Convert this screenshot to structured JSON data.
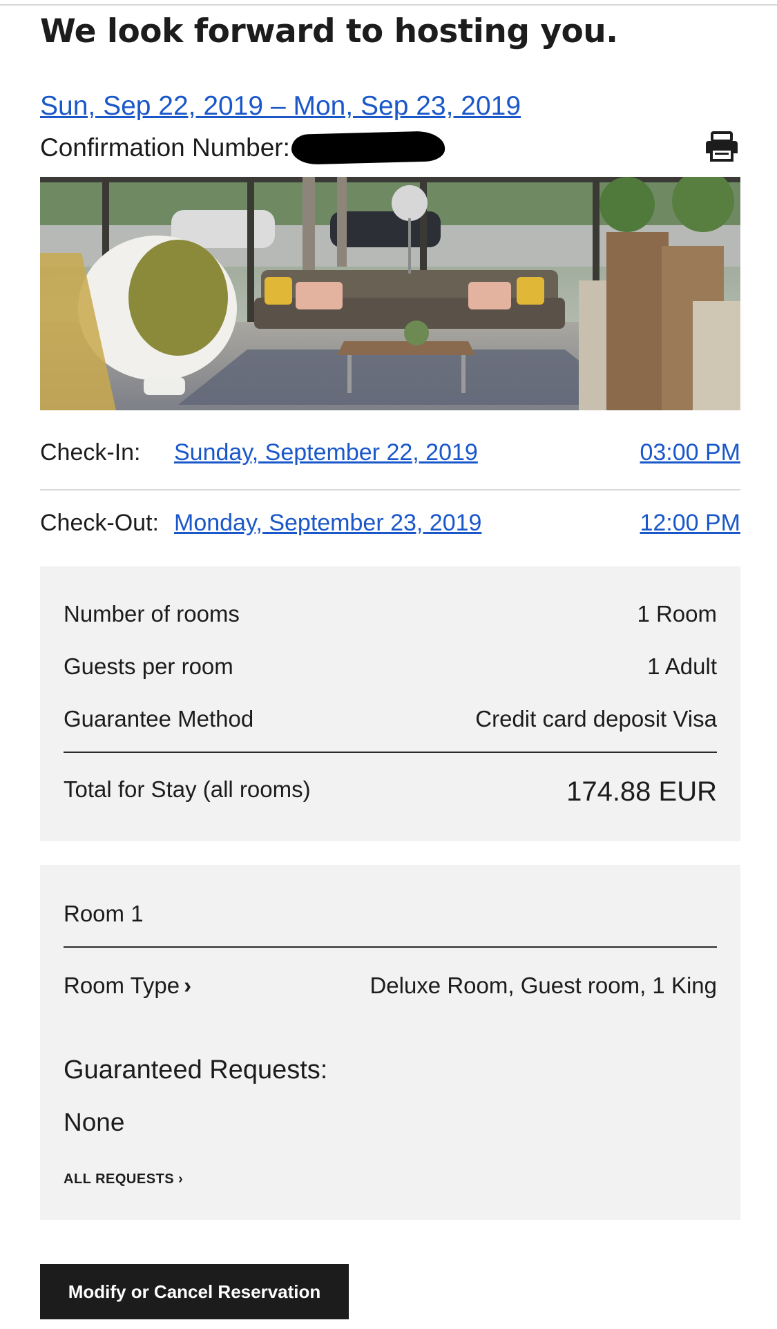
{
  "header": {
    "title": "We look forward to hosting you.",
    "date_range": "Sun, Sep 22, 2019 – Mon, Sep 23, 2019",
    "confirmation_label": "Confirmation Number:",
    "confirmation_value_state": "redacted"
  },
  "icons": {
    "print": "print-icon"
  },
  "hero_image": {
    "description": "hotel lobby photo"
  },
  "stay": {
    "check_in_label": "Check-In:",
    "check_in_date": "Sunday, September 22, 2019",
    "check_in_time": "03:00 PM",
    "check_out_label": "Check-Out:",
    "check_out_date": "Monday, September 23, 2019",
    "check_out_time": "12:00 PM"
  },
  "summary": {
    "rooms_label": "Number of rooms",
    "rooms_value": "1 Room",
    "guests_label": "Guests per room",
    "guests_value": "1 Adult",
    "guarantee_label": "Guarantee Method",
    "guarantee_value": "Credit card deposit Visa",
    "total_label": "Total for Stay (all rooms)",
    "total_value": "174.88 EUR"
  },
  "room": {
    "title": "Room 1",
    "type_label": "Room Type",
    "type_value": "Deluxe Room, Guest room, 1 King",
    "requests_heading": "Guaranteed Requests:",
    "requests_value": "None",
    "all_requests_link": "ALL REQUESTS"
  },
  "actions": {
    "modify_label": "Modify or Cancel Reservation"
  },
  "colors": {
    "link": "#1a57c9",
    "panel_bg": "#f2f2f2",
    "button_bg": "#1c1c1c",
    "text": "#1c1c1c"
  }
}
